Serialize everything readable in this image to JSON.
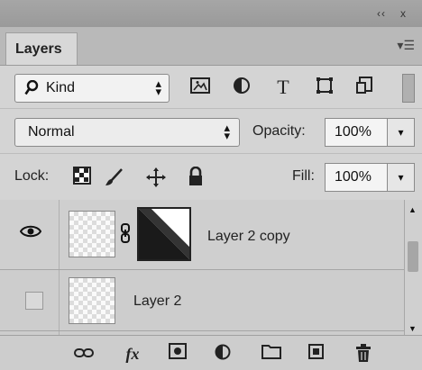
{
  "window": {
    "collapse_glyph": "‹‹",
    "close_glyph": "x"
  },
  "panel": {
    "tab_title": "Layers",
    "menu_glyph": "▾☰"
  },
  "filter": {
    "search_glyph": "⚲",
    "kind_label": "Kind",
    "icons": [
      "image-filter-icon",
      "adjustment-filter-icon",
      "type-filter-icon",
      "shape-filter-icon",
      "smart-object-filter-icon"
    ]
  },
  "blend": {
    "mode": "Normal",
    "opacity_label": "Opacity:",
    "opacity_value": "100%"
  },
  "lock": {
    "label": "Lock:",
    "fill_label": "Fill:",
    "fill_value": "100%"
  },
  "layers": [
    {
      "name": "Layer 2 copy",
      "visible": true,
      "has_mask": true
    },
    {
      "name": "Layer 2",
      "visible": false,
      "has_mask": false
    }
  ],
  "bottom_icons": [
    "link-layers-icon",
    "fx-icon",
    "add-mask-icon",
    "adjustment-layer-icon",
    "new-group-icon",
    "new-layer-icon",
    "delete-layer-icon"
  ],
  "labels": {
    "fx": "fx"
  },
  "colors": {
    "panel_bg": "#d4d4d4",
    "header_bg": "#a0a0a0",
    "list_bg": "#c7c7c7"
  }
}
